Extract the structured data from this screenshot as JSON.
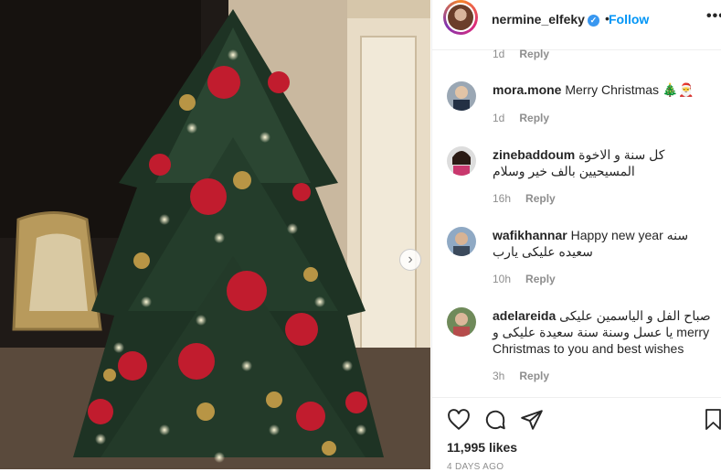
{
  "post": {
    "username": "nermine_elfeky",
    "follow_label": "Follow",
    "more_label": "•••",
    "dot": "•"
  },
  "top_meta": {
    "time": "1d",
    "reply": "Reply"
  },
  "comments": [
    {
      "user": "mora.mone",
      "text": "Merry Christmas 🎄🎅",
      "time": "1d",
      "reply": "Reply"
    },
    {
      "user": "zinebaddoum",
      "text": "كل سنة و الاخوة المسيحيين بالف خير وسلام",
      "time": "16h",
      "reply": "Reply"
    },
    {
      "user": "wafikhannar",
      "text": "Happy new year سنه سعيده عليكى يارب",
      "time": "10h",
      "reply": "Reply"
    },
    {
      "user": "adelareida",
      "text": "صباح الفل و الياسمين عليكى يا عسل وسنة سنة سعيدة عليكى و merry Christmas to you and best wishes",
      "time": "3h",
      "reply": "Reply"
    }
  ],
  "likes": "11,995 likes",
  "date": "4 DAYS AGO",
  "colors": {
    "link": "#0095f6",
    "muted": "#8e8e8e",
    "text": "#262626",
    "divider": "#efefef"
  },
  "icons": [
    "heart-icon",
    "comment-icon",
    "share-icon",
    "bookmark-icon",
    "verified-icon",
    "chevron-right-icon"
  ]
}
